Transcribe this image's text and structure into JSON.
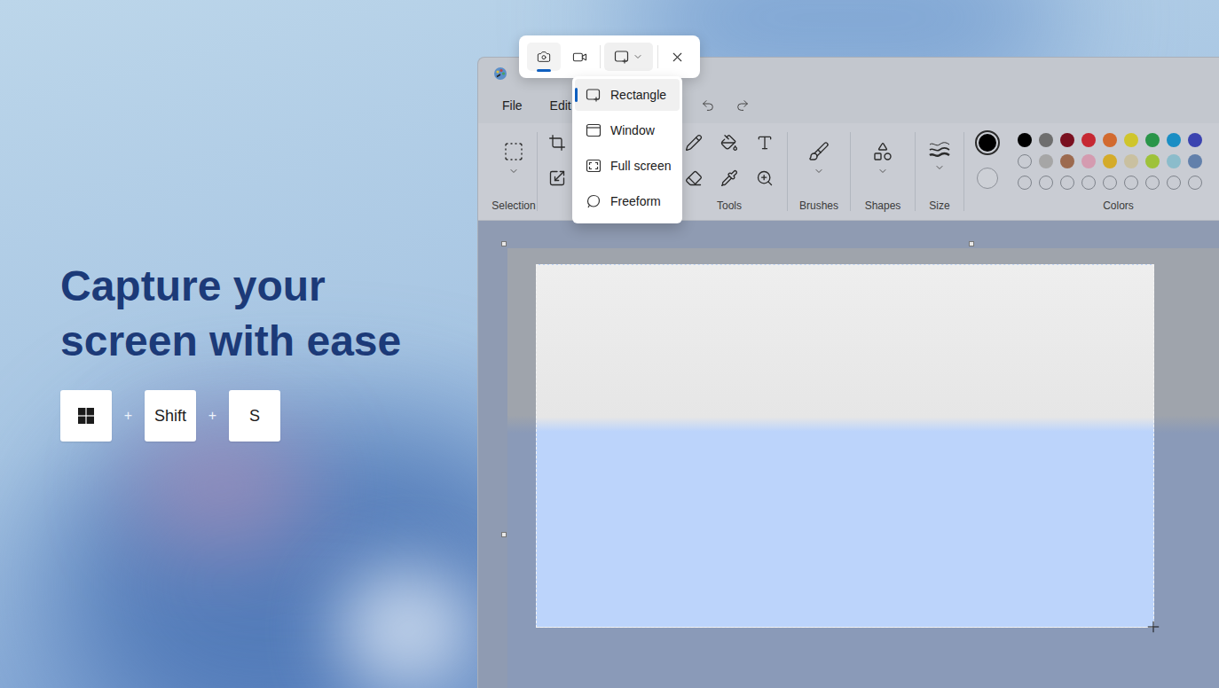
{
  "hero": {
    "title_lines": [
      "Capture your",
      "screen with ease"
    ],
    "keys": [
      {
        "kind": "windows-logo"
      },
      {
        "kind": "text",
        "label": "Shift"
      },
      {
        "kind": "text",
        "label": "S"
      }
    ],
    "key_separator": "+"
  },
  "snipping_toolbar": {
    "modes": [
      {
        "kind": "screenshot",
        "selected": true
      },
      {
        "kind": "video",
        "selected": false
      }
    ],
    "shape_dropdown": {
      "expanded": true
    },
    "shape_menu": [
      {
        "label": "Rectangle",
        "kind": "rectangle",
        "selected": true
      },
      {
        "label": "Window",
        "kind": "window",
        "selected": false
      },
      {
        "label": "Full screen",
        "kind": "fullscreen",
        "selected": false
      },
      {
        "label": "Freeform",
        "kind": "freeform",
        "selected": false
      }
    ]
  },
  "paint": {
    "menu": [
      "File",
      "Edit"
    ],
    "ribbon_groups": [
      {
        "kind": "selection",
        "label": "Selection"
      },
      {
        "kind": "image"
      },
      {
        "kind": "tools",
        "label": "Tools"
      },
      {
        "kind": "brushes",
        "label": "Brushes"
      },
      {
        "kind": "shapes",
        "label": "Shapes"
      },
      {
        "kind": "size",
        "label": "Size"
      },
      {
        "kind": "colors",
        "label": "Colors"
      }
    ],
    "current_colors": [
      {
        "color": "#000000"
      },
      {
        "color": "#cdd0d6"
      }
    ],
    "palette": [
      [
        {
          "filled": true,
          "color": "#000000"
        },
        {
          "filled": true,
          "color": "#6e6e6e"
        },
        {
          "filled": true,
          "color": "#7a1020"
        },
        {
          "filled": true,
          "color": "#c62833"
        },
        {
          "filled": true,
          "color": "#d26a2f"
        },
        {
          "filled": true,
          "color": "#cfc52c"
        },
        {
          "filled": true,
          "color": "#2a9549"
        },
        {
          "filled": true,
          "color": "#1a8ec4"
        },
        {
          "filled": true,
          "color": "#3b43b0"
        }
      ],
      [
        {
          "filled": false
        },
        {
          "filled": true,
          "color": "#a6a6a6"
        },
        {
          "filled": true,
          "color": "#9c6a4f"
        },
        {
          "filled": true,
          "color": "#d49bb0"
        },
        {
          "filled": true,
          "color": "#d4ab2a"
        },
        {
          "filled": true,
          "color": "#c9c0a0"
        },
        {
          "filled": true,
          "color": "#9ec23a"
        },
        {
          "filled": true,
          "color": "#8bbccb"
        },
        {
          "filled": true,
          "color": "#6280ab"
        }
      ],
      [
        {
          "filled": false
        },
        {
          "filled": false
        },
        {
          "filled": false
        },
        {
          "filled": false
        },
        {
          "filled": false
        },
        {
          "filled": false
        },
        {
          "filled": false
        },
        {
          "filled": false
        },
        {
          "filled": false
        }
      ]
    ],
    "canvas": {
      "selection_active": true
    }
  }
}
